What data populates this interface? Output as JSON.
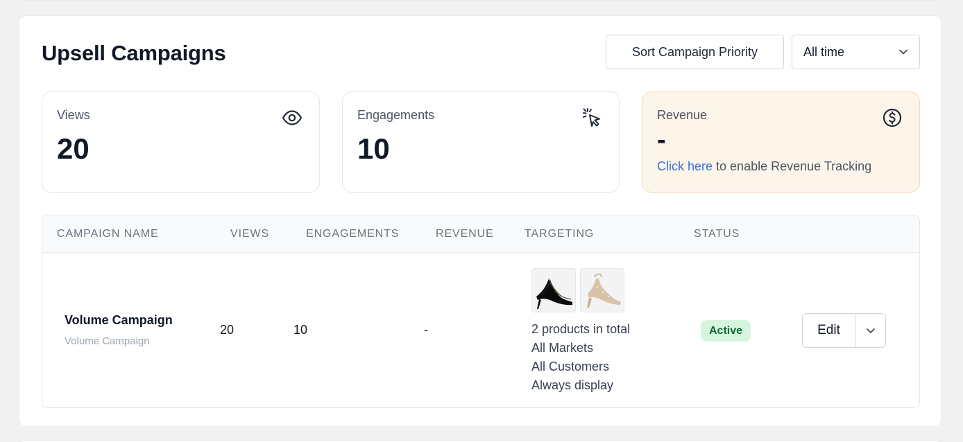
{
  "header": {
    "title": "Upsell Campaigns",
    "sort_label": "Sort Campaign Priority",
    "time_filter": "All time"
  },
  "stats": {
    "views": {
      "label": "Views",
      "value": "20",
      "icon": "eye-icon"
    },
    "engagements": {
      "label": "Engagements",
      "value": "10",
      "icon": "cursor-click-icon"
    },
    "revenue": {
      "label": "Revenue",
      "value": "-",
      "icon": "dollar-circle-icon",
      "link_text": "Click here",
      "note": " to enable Revenue Tracking",
      "link_color": "#3b6fd8"
    }
  },
  "table": {
    "headers": [
      "CAMPAIGN NAME",
      "VIEWS",
      "ENGAGEMENTS",
      "REVENUE",
      "TARGETING",
      "STATUS"
    ],
    "rows": [
      {
        "name": "Volume Campaign",
        "subtitle": "Volume Campaign",
        "views": "20",
        "engagements": "10",
        "revenue": "-",
        "targeting": {
          "products": [
            "black-heel-thumbnail",
            "glitter-heel-thumbnail"
          ],
          "lines": [
            "2 products in total",
            "All Markets",
            "All Customers",
            "Always display"
          ]
        },
        "status": "Active",
        "status_color": "#d6f5df",
        "action": "Edit"
      }
    ]
  }
}
